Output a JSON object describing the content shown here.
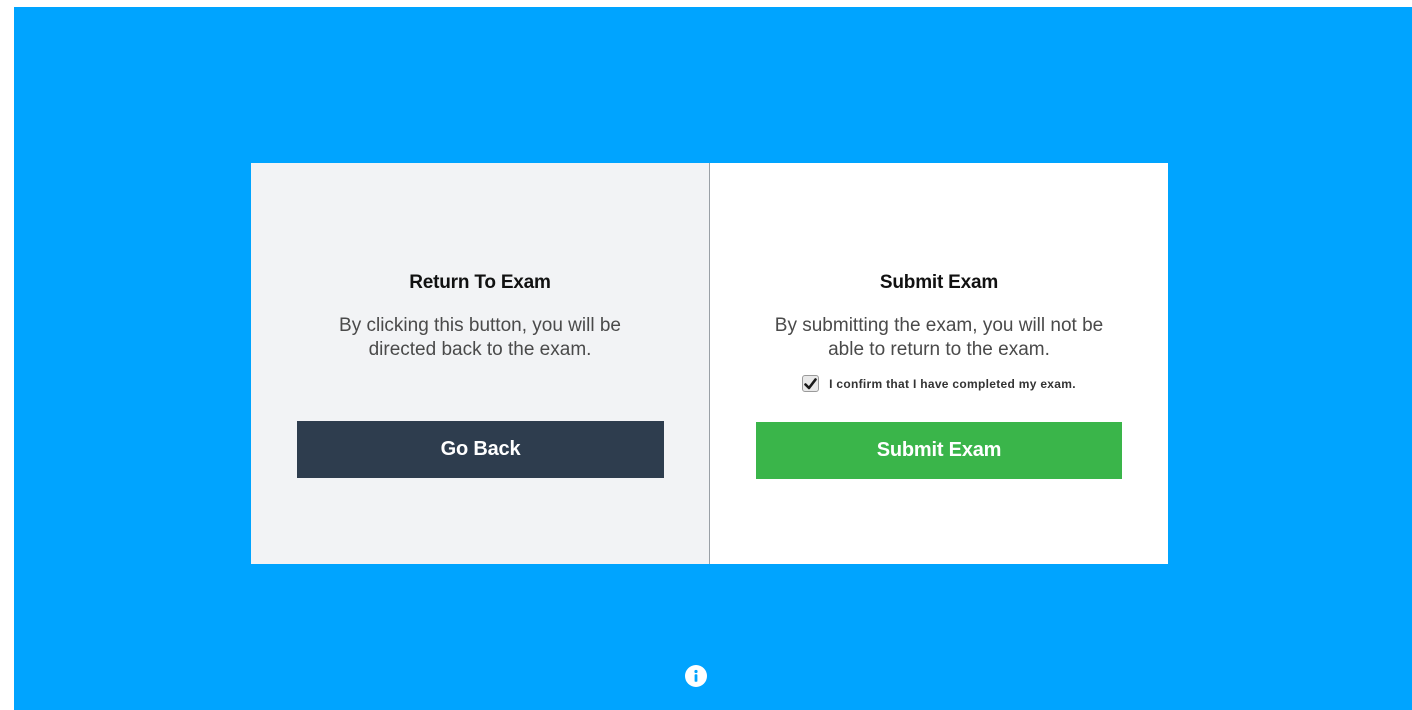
{
  "left_panel": {
    "title": "Return To Exam",
    "description": "By clicking this button, you will be directed back to the exam.",
    "button_label": "Go Back"
  },
  "right_panel": {
    "title": "Submit Exam",
    "description": "By submitting the exam, you will not be able to return to the exam.",
    "confirm_label": "I confirm that I have completed my exam.",
    "confirm_checked": true,
    "button_label": "Submit Exam"
  },
  "icons": {
    "checkbox": "check-icon",
    "footer": "info-icon"
  },
  "colors": {
    "background": "#00a4ff",
    "left_panel": "#f2f3f5",
    "right_panel": "#ffffff",
    "go_back_button": "#2e3d4e",
    "submit_button": "#3ab54a"
  }
}
